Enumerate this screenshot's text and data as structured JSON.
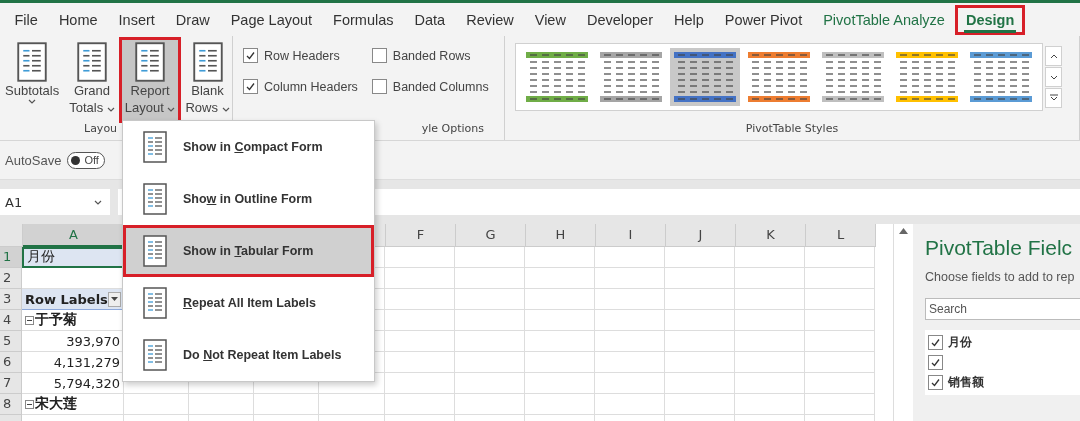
{
  "menu_tabs": [
    {
      "label": "File",
      "kind": "normal",
      "selected": false,
      "highlighted": false
    },
    {
      "label": "Home",
      "kind": "normal",
      "selected": false,
      "highlighted": false
    },
    {
      "label": "Insert",
      "kind": "normal",
      "selected": false,
      "highlighted": false
    },
    {
      "label": "Draw",
      "kind": "normal",
      "selected": false,
      "highlighted": false
    },
    {
      "label": "Page Layout",
      "kind": "normal",
      "selected": false,
      "highlighted": false
    },
    {
      "label": "Formulas",
      "kind": "normal",
      "selected": false,
      "highlighted": false
    },
    {
      "label": "Data",
      "kind": "normal",
      "selected": false,
      "highlighted": false
    },
    {
      "label": "Review",
      "kind": "normal",
      "selected": false,
      "highlighted": false
    },
    {
      "label": "View",
      "kind": "normal",
      "selected": false,
      "highlighted": false
    },
    {
      "label": "Developer",
      "kind": "normal",
      "selected": false,
      "highlighted": false
    },
    {
      "label": "Help",
      "kind": "normal",
      "selected": false,
      "highlighted": false
    },
    {
      "label": "Power Pivot",
      "kind": "normal",
      "selected": false,
      "highlighted": false
    },
    {
      "label": "PivotTable Analyze",
      "kind": "contextual",
      "selected": false,
      "highlighted": false
    },
    {
      "label": "Design",
      "kind": "contextual",
      "selected": true,
      "highlighted": true
    }
  ],
  "layout_group": {
    "label": "Layou",
    "buttons": [
      {
        "line1": "Subtotals",
        "selected": false,
        "highlighted": false
      },
      {
        "line1": "Grand",
        "line2": "Totals",
        "selected": false,
        "highlighted": false
      },
      {
        "line1": "Report",
        "line2": "Layout",
        "selected": true,
        "highlighted": true
      },
      {
        "line1": "Blank",
        "line2": "Rows",
        "selected": false,
        "highlighted": false
      }
    ]
  },
  "style_options": {
    "label": "yle Options",
    "options": [
      {
        "label": "Row Headers",
        "checked": true
      },
      {
        "label": "Banded Rows",
        "checked": false
      },
      {
        "label": "Column Headers",
        "checked": true
      },
      {
        "label": "Banded Columns",
        "checked": false
      }
    ]
  },
  "styles_gallery": {
    "label": "PivotTable Styles",
    "styles": [
      {
        "color": "#70ad47",
        "selected": false
      },
      {
        "color": "#a5a5a5",
        "selected": false
      },
      {
        "color": "#4472c4",
        "selected": true
      },
      {
        "color": "#ed7d31",
        "selected": false
      },
      {
        "color": "#bfbfbf",
        "selected": false
      },
      {
        "color": "#ffc000",
        "selected": false
      },
      {
        "color": "#5b9bd5",
        "selected": false
      }
    ]
  },
  "autosave": {
    "label": "AutoSave",
    "toggle": "Off",
    "on": false
  },
  "name_box": {
    "value": "A1"
  },
  "sheet": {
    "columns": [
      "A",
      "F",
      "G",
      "H",
      "I",
      "J",
      "K",
      "L"
    ],
    "rows": [
      {
        "number": "1",
        "kind": "field",
        "text": "月份",
        "selected": true
      },
      {
        "number": "2",
        "kind": "empty",
        "text": "",
        "selected": false
      },
      {
        "number": "3",
        "kind": "header",
        "text": "Row Labels",
        "selected": false
      },
      {
        "number": "4",
        "kind": "group",
        "text": "于予菊",
        "selected": false
      },
      {
        "number": "5",
        "kind": "value",
        "text": "393,970",
        "selected": false
      },
      {
        "number": "6",
        "kind": "value",
        "text": "4,131,279",
        "selected": false
      },
      {
        "number": "7",
        "kind": "value",
        "text": "5,794,320",
        "selected": false
      },
      {
        "number": "8",
        "kind": "group",
        "text": "宋大莲",
        "selected": false
      }
    ]
  },
  "dropdown_menu": {
    "items": [
      {
        "label_before": "Show in ",
        "label_accelerator": "C",
        "label_after": "ompact Form",
        "selected": false
      },
      {
        "label_before": "Sho",
        "label_accelerator": "w",
        "label_after": " in Outline Form",
        "selected": false
      },
      {
        "label_before": "Show in ",
        "label_accelerator": "T",
        "label_after": "abular Form",
        "selected": true
      },
      {
        "label_accelerator": "R",
        "label_after": "epeat All Item Labels",
        "selected": false
      },
      {
        "label_before": "Do ",
        "label_accelerator": "N",
        "label_after": "ot Repeat Item Labels",
        "selected": false
      }
    ]
  },
  "field_list": {
    "title": "PivotTable Fielc",
    "subtitle": "Choose fields to add to rep",
    "search": {
      "placeholder": "Search"
    },
    "fields": [
      {
        "label": "月份",
        "checked": true
      },
      {
        "checked": true
      },
      {
        "label": "销售额",
        "checked": true
      }
    ]
  }
}
